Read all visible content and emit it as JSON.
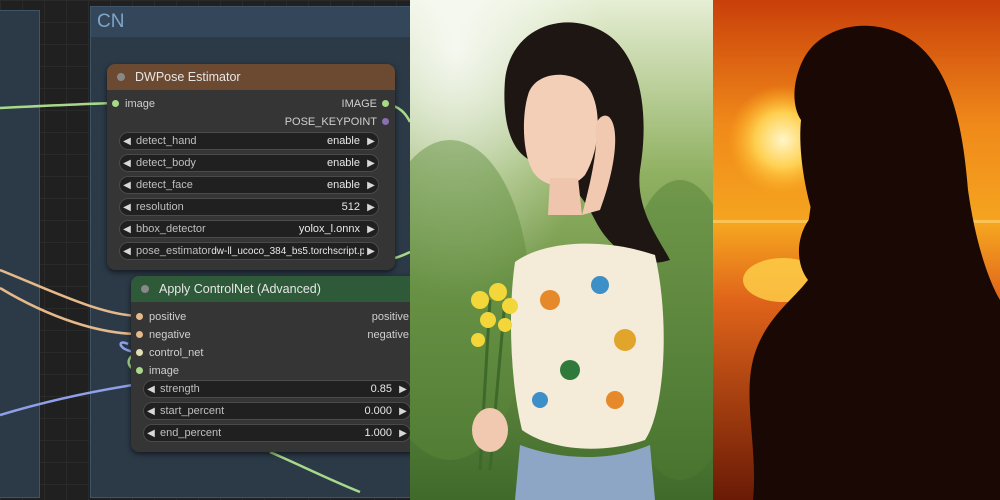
{
  "group": {
    "title": "CN"
  },
  "dwpose": {
    "title": "DWPose Estimator",
    "input_image": "image",
    "output_image": "IMAGE",
    "output_keypoint": "POSE_KEYPOINT",
    "widgets": [
      {
        "label": "detect_hand",
        "value": "enable"
      },
      {
        "label": "detect_body",
        "value": "enable"
      },
      {
        "label": "detect_face",
        "value": "enable"
      },
      {
        "label": "resolution",
        "value": "512"
      },
      {
        "label": "bbox_detector",
        "value": "yolox_l.onnx"
      },
      {
        "label": "pose_estimator",
        "value": "dw-ll_ucoco_384_bs5.torchscript.pt"
      }
    ]
  },
  "controlnet": {
    "title": "Apply ControlNet (Advanced)",
    "inputs": {
      "positive": "positive",
      "negative": "negative",
      "control_net": "control_net",
      "image": "image"
    },
    "outputs": {
      "positive": "positive",
      "negative": "negative"
    },
    "widgets": [
      {
        "label": "strength",
        "value": "0.85"
      },
      {
        "label": "start_percent",
        "value": "0.000"
      },
      {
        "label": "end_percent",
        "value": "1.000"
      }
    ]
  },
  "colors": {
    "group_bg": "#2c3a48",
    "dwpose_header": "#6b4a31",
    "controlnet_header": "#2f5a3a",
    "wire_image": "#a8d98a",
    "wire_conditioning": "#e6b98a",
    "wire_controlnet": "#8fa0e8"
  },
  "images": [
    {
      "name": "reference-photo-woman-flowers"
    },
    {
      "name": "reference-photo-sunset-silhouette"
    }
  ]
}
